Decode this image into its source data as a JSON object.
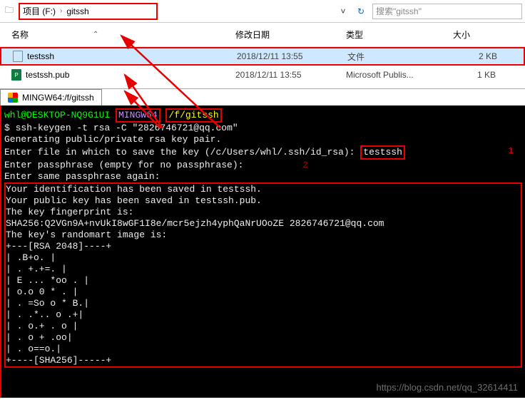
{
  "explorer": {
    "breadcrumb": {
      "drive_label": "项目 (F:)",
      "folder": "gitssh"
    },
    "search_placeholder": "搜索\"gitssh\"",
    "columns": {
      "name": "名称",
      "date": "修改日期",
      "type": "类型",
      "size": "大小"
    },
    "rows": [
      {
        "name": "testssh",
        "date": "2018/12/11 13:55",
        "type": "文件",
        "size": "2 KB",
        "selected": true,
        "icon": "doc"
      },
      {
        "name": "testssh.pub",
        "date": "2018/12/11 13:55",
        "type": "Microsoft Publis...",
        "size": "1 KB",
        "selected": false,
        "icon": "pub"
      }
    ]
  },
  "terminal": {
    "tab_title": "MINGW64:/f/gitssh",
    "prompt_user": "whl@DESKTOP-NQ9G1UI",
    "prompt_env": "MINGW64",
    "prompt_path": "/f/gitssh",
    "cmd_prefix": "$",
    "cmd": "ssh-keygen -t rsa -C \"2826746721@qq.com\"",
    "line_gen": "Generating public/private rsa key pair.",
    "line_enter_file_prefix": "Enter file in which to save the key (/c/Users/whl/.ssh/id_rsa):",
    "input_file": "testssh",
    "ann1": "1",
    "line_pass1": "Enter passphrase (empty for no passphrase):",
    "line_pass2": "Enter same passphrase again:",
    "ann2": "2",
    "out_identification": "Your identification has been saved in testssh.",
    "out_pubkey": "Your public key has been saved in testssh.pub.",
    "out_fp_label": "The key fingerprint is:",
    "out_fp": "SHA256:Q2VGn9A+nvUkI8wGF1I8e/mcr5ejzh4yphQaNrUOoZE 2826746721@qq.com",
    "out_art_label": "The key's randomart image is:",
    "art": [
      "+---[RSA 2048]----+",
      "|        .B+o.    |",
      "|      .  +.+=.   |",
      "|     E ... *oo . |",
      "|      o.o  0 * . |",
      "|     .  =So o * B.|",
      "|      . .*.. o  .+|",
      "|       . o.+ . o |",
      "|        . o +  .oo|",
      "|         . o==o.|",
      "+----[SHA256]-----+"
    ]
  },
  "watermark": "https://blog.csdn.net/qq_32614411",
  "colors": {
    "annotation_red": "#e60000",
    "term_green": "#00ff00",
    "term_yellow": "#ffff00",
    "term_purple": "#c88cff"
  }
}
